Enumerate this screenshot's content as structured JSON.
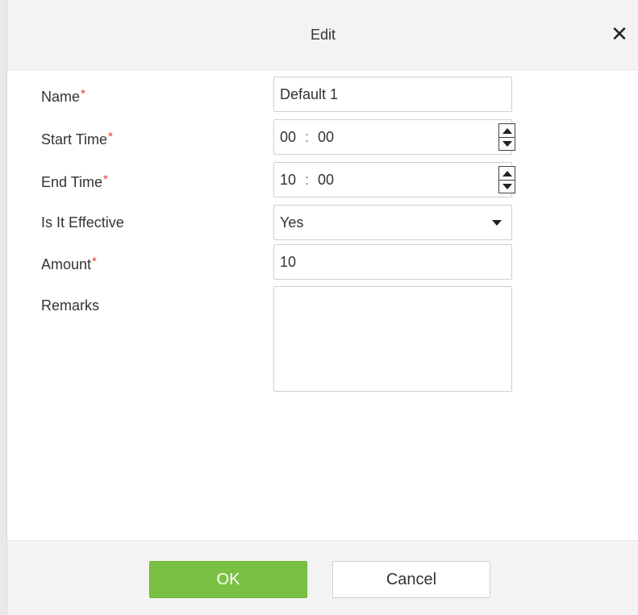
{
  "dialog": {
    "title": "Edit",
    "close_icon": "close-icon",
    "close_glyph": "✕"
  },
  "form": {
    "name": {
      "label": "Name",
      "required_mark": "*",
      "value": "Default 1"
    },
    "start_time": {
      "label": "Start Time",
      "required_mark": "*",
      "hour": "00",
      "sep": ":",
      "minute": "00"
    },
    "end_time": {
      "label": "End Time",
      "required_mark": "*",
      "hour": "10",
      "sep": ":",
      "minute": "00"
    },
    "is_effective": {
      "label": "Is It Effective",
      "value": "Yes"
    },
    "amount": {
      "label": "Amount",
      "required_mark": "*",
      "value": "10"
    },
    "remarks": {
      "label": "Remarks",
      "value": ""
    }
  },
  "footer": {
    "ok_label": "OK",
    "cancel_label": "Cancel"
  },
  "colors": {
    "ok_button": "#7ac143",
    "required_mark": "#e53935",
    "header_bg": "#f3f3f3"
  }
}
